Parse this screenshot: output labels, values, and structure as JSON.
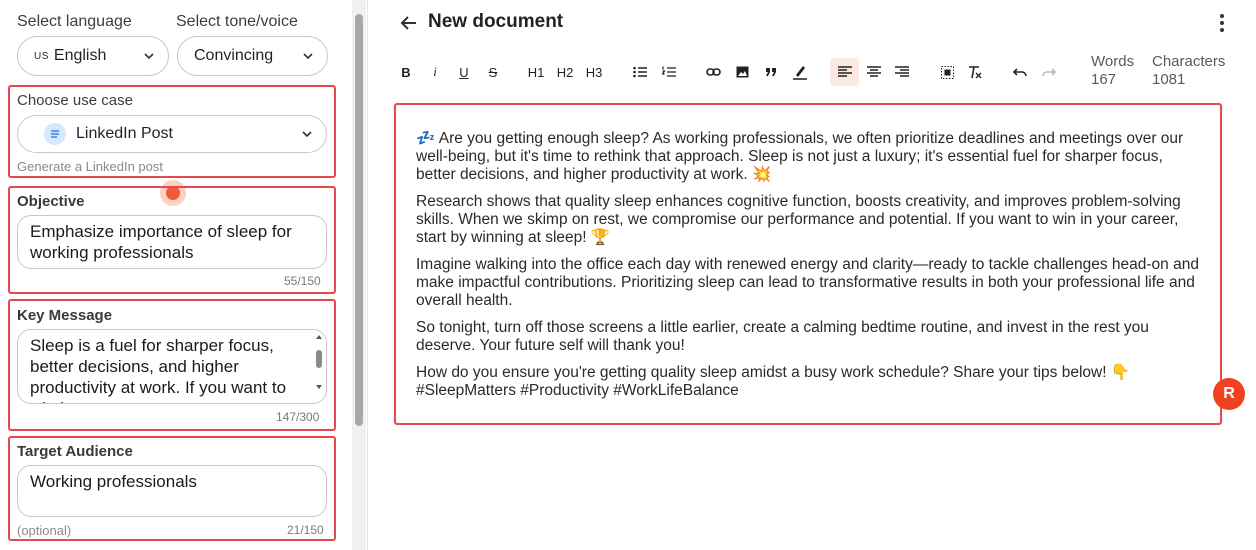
{
  "left": {
    "language": {
      "label": "Select language",
      "flag": "US",
      "value": "English"
    },
    "tone": {
      "label": "Select tone/voice",
      "value": "Convincing"
    },
    "use_case": {
      "title": "Choose use case",
      "value": "LinkedIn Post",
      "hint": "Generate a LinkedIn post"
    },
    "objective": {
      "title": "Objective",
      "value": "Emphasize importance of sleep for working professionals",
      "counter": "55/150"
    },
    "key_message": {
      "title": "Key Message",
      "value": "Sleep is a fuel for sharper focus, better decisions, and higher productivity at work. If you want to win in",
      "counter": "147/300"
    },
    "target_audience": {
      "title": "Target Audience",
      "value": "Working professionals",
      "optional": "(optional)",
      "counter": "21/150"
    }
  },
  "header": {
    "title": "New document"
  },
  "toolbar": {
    "bold": "B",
    "italic": "i",
    "underline": "U",
    "strike": "S",
    "h1": "H1",
    "h2": "H2",
    "h3": "H3"
  },
  "stats": {
    "words_label": "Words",
    "words": "167",
    "chars_label": "Characters",
    "chars": "1081"
  },
  "editor": {
    "paragraphs": [
      "💤 Are you getting enough sleep? As working professionals, we often prioritize deadlines and meetings over our well-being, but it's time to rethink that approach. Sleep is not just a luxury; it's essential fuel for sharper focus, better decisions, and higher productivity at work. 💥",
      "Research shows that quality sleep enhances cognitive function, boosts creativity, and improves problem-solving skills. When we skimp on rest, we compromise our performance and potential. If you want to win in your career, start by winning at sleep! 🏆",
      "Imagine walking into the office each day with renewed energy and clarity—ready to tackle challenges head-on and make impactful contributions. Prioritizing sleep can lead to transformative results in both your professional life and overall health.",
      "So tonight, turn off those screens a little earlier, create a calming bedtime routine, and invest in the rest you deserve. Your future self will thank you!",
      "How do you ensure you're getting quality sleep amidst a busy work schedule? Share your tips below! 👇 #SleepMatters #Productivity #WorkLifeBalance"
    ]
  },
  "badge": {
    "letter": "R"
  },
  "colors": {
    "accent": "#e5484d",
    "badge": "#f0421e"
  }
}
